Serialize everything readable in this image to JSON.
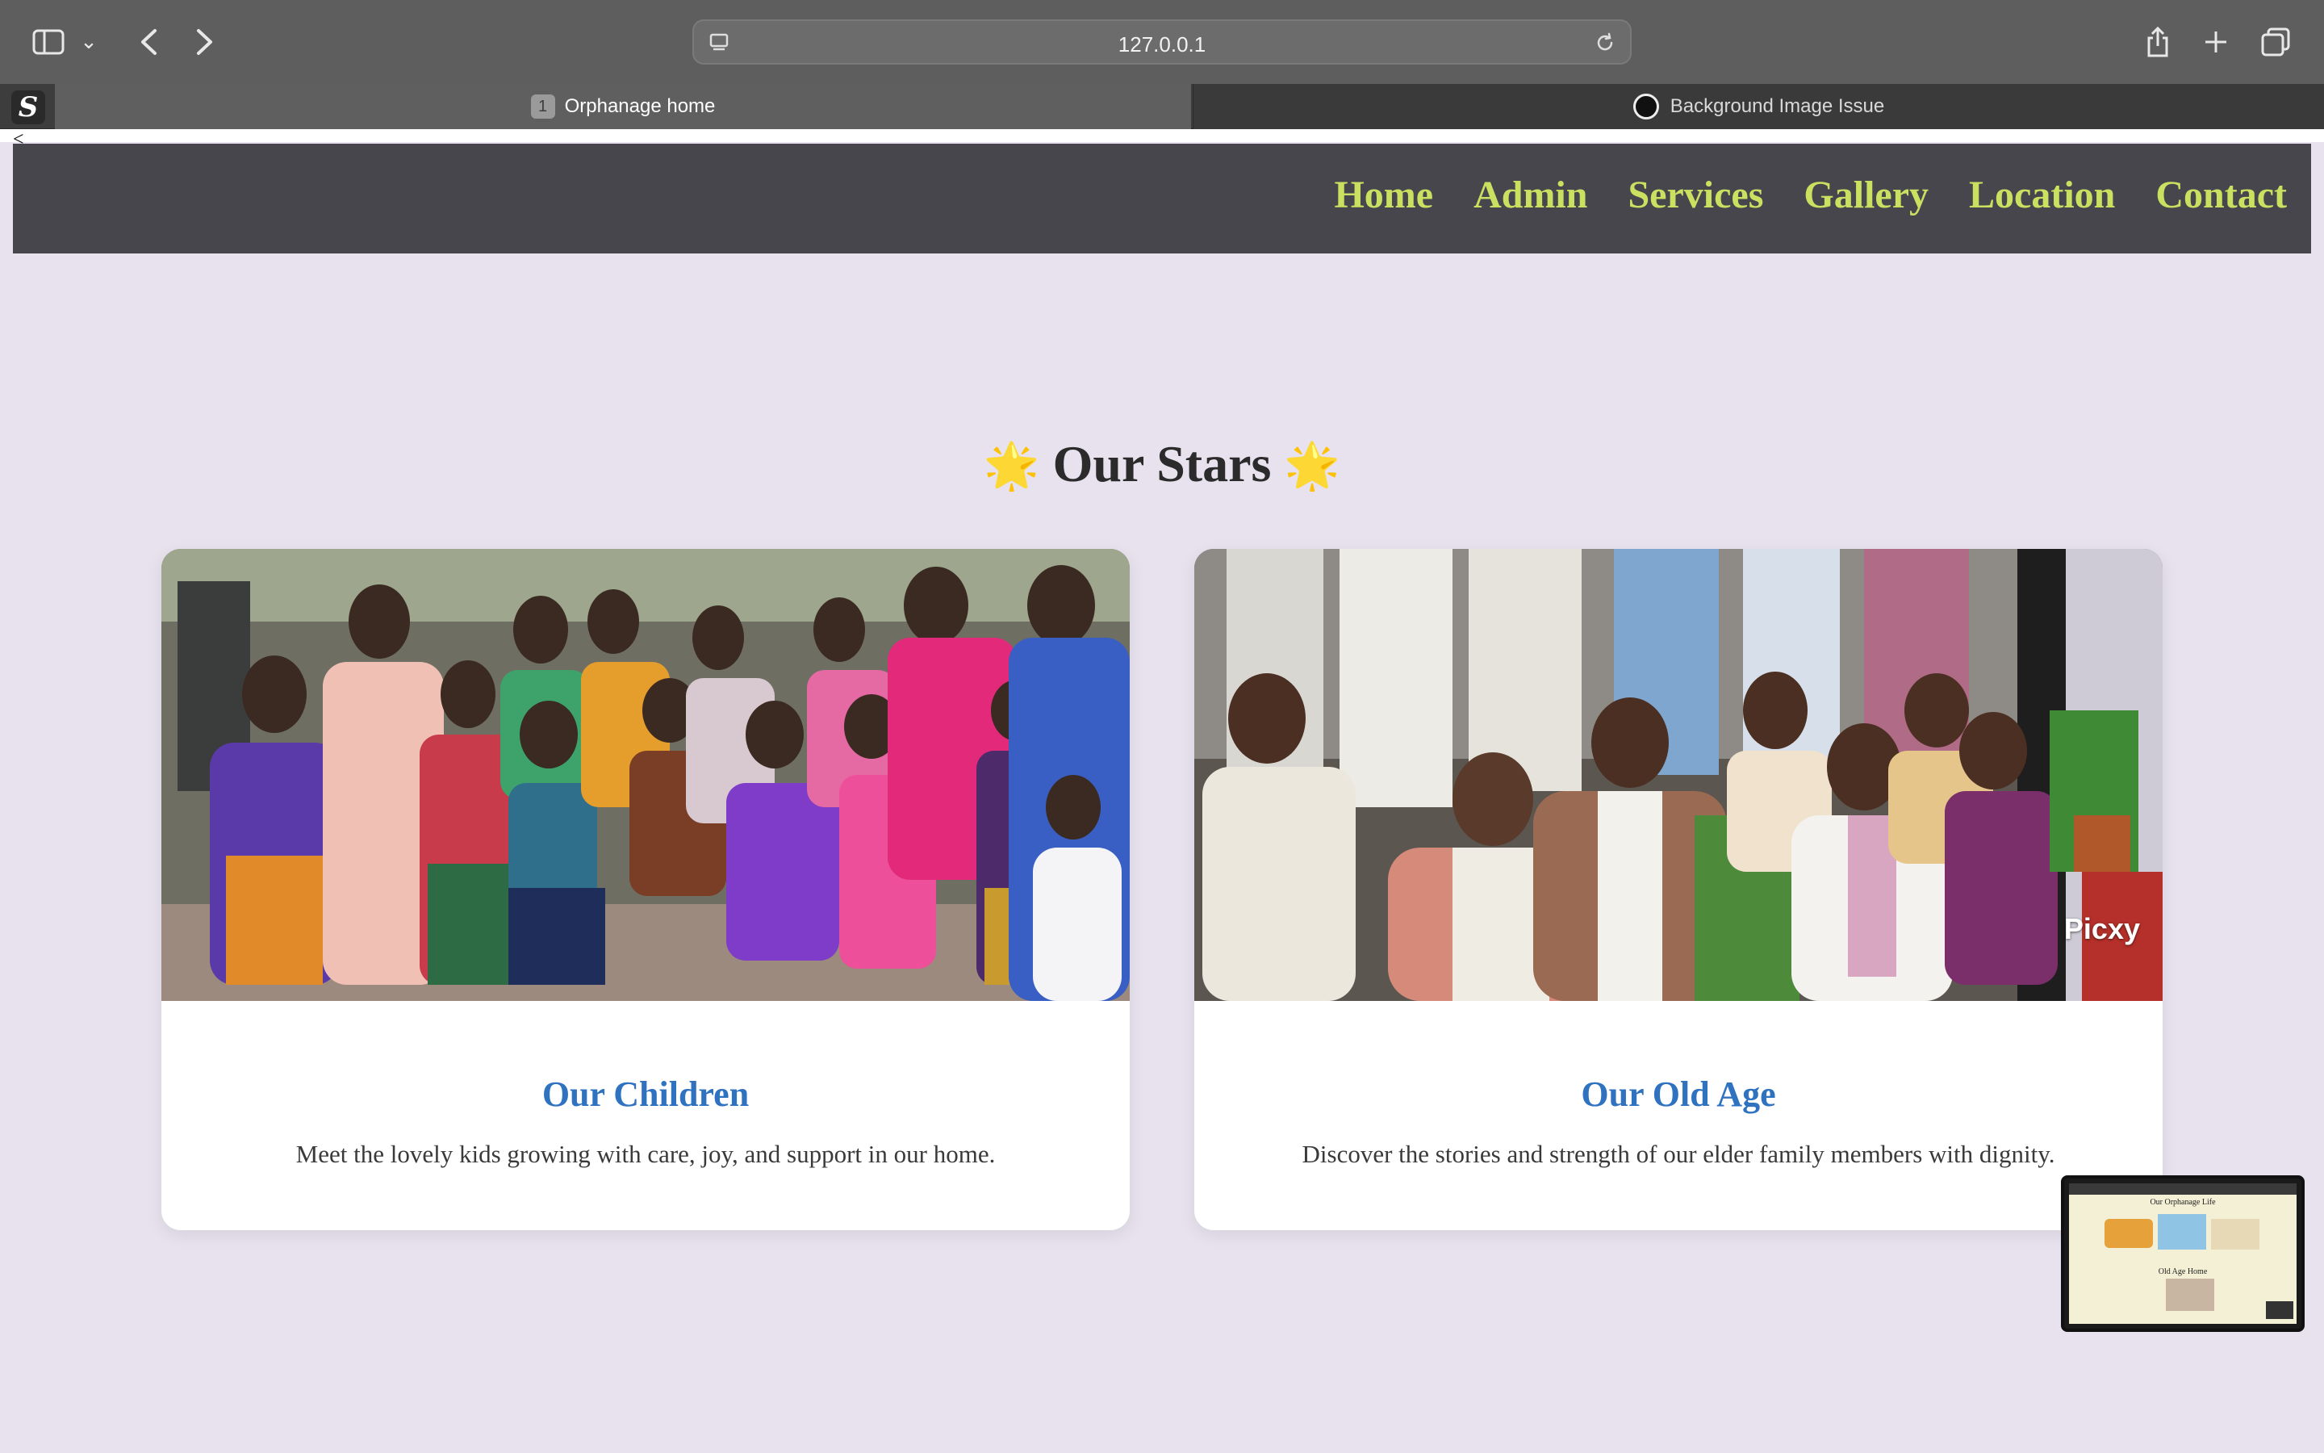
{
  "browser": {
    "url": "127.0.0.1",
    "tabs": [
      {
        "number": "1",
        "label": "Orphanage home",
        "active": true
      },
      {
        "label": "Background Image Issue",
        "active": false
      }
    ]
  },
  "nav": {
    "items": [
      "Home",
      "Admin",
      "Services",
      "Gallery",
      "Location",
      "Contact"
    ],
    "color": "#c9e060"
  },
  "stray_text": "<",
  "section": {
    "star": "🌟",
    "title": "Our Stars"
  },
  "cards": [
    {
      "title": "Our Children",
      "description": "Meet the lovely kids growing with care, joy, and support in our home."
    },
    {
      "title": "Our Old Age",
      "description": "Discover the stories and strength of our elder family members with dignity.",
      "watermark": "Picxy"
    }
  ],
  "thumbnail": {
    "title": "Our Orphanage Life",
    "subtitle": "Old Age Home"
  },
  "colors": {
    "page_bg": "#e7e2ee",
    "navbar_bg": "#47464c",
    "card_title": "#2f72c0"
  }
}
